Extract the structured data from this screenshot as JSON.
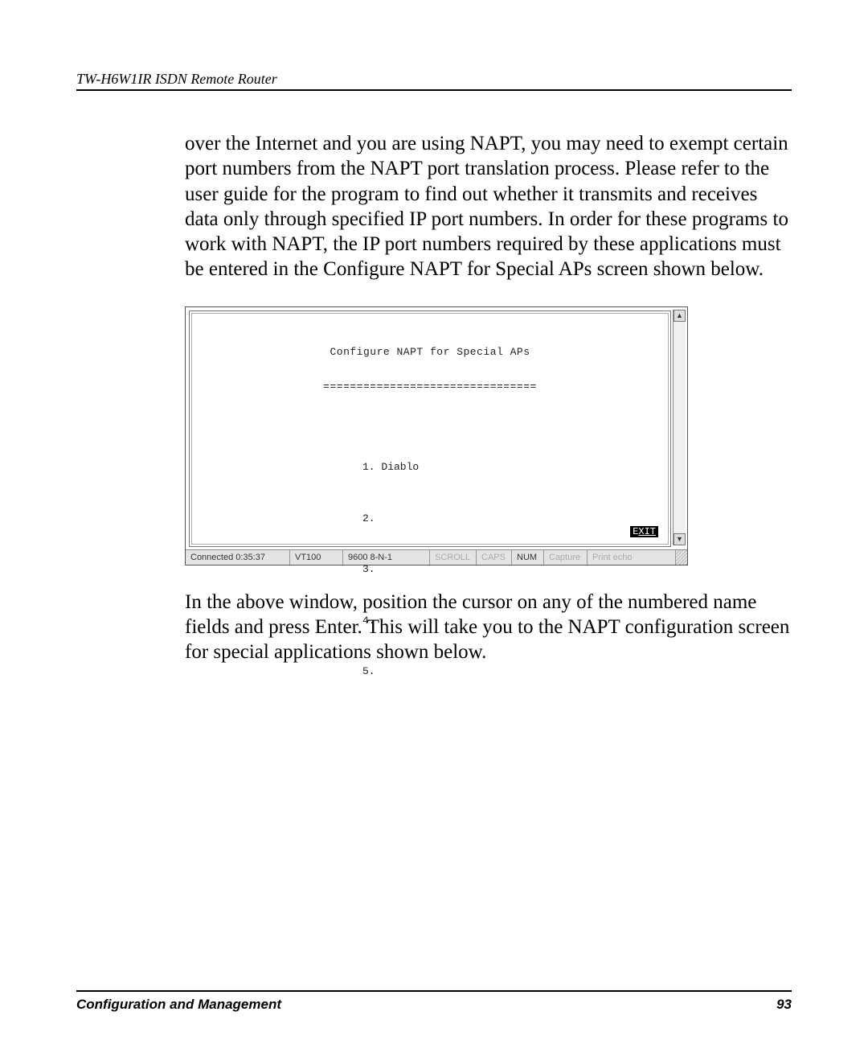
{
  "header": {
    "title": "TW-H6W1IR ISDN Remote Router"
  },
  "paragraphs": {
    "p1": "over the Internet and you are using NAPT, you may need to exempt certain port numbers from the NAPT port translation process. Please refer to the user guide for the program to find out whether it transmits and receives data only through specified IP port numbers. In order for these programs to work with NAPT, the IP port numbers required by these applications must be entered in the Configure NAPT for Special APs screen shown below.",
    "p2": "In the above window, position the cursor on any of the numbered name fields and press Enter. This will take you to the NAPT configuration screen for special applications shown below."
  },
  "terminal": {
    "title": "Configure NAPT for Special APs",
    "underline": "================================",
    "items": {
      "i1": "1. Diablo",
      "i2": "2.",
      "i3": "3.",
      "i4": "4.",
      "i5": "5."
    },
    "exit_prefix": "E",
    "exit_suffix": "XIT",
    "scroll_up_glyph": "▲",
    "scroll_down_glyph": "▼"
  },
  "status_bar": {
    "connected": "Connected 0:35:37",
    "emulation": "VT100",
    "settings": "9600 8-N-1",
    "scroll": "SCROLL",
    "caps": "CAPS",
    "num": "NUM",
    "capture": "Capture",
    "print_echo": "Print echo"
  },
  "footer": {
    "left": "Configuration and Management",
    "right": "93"
  }
}
